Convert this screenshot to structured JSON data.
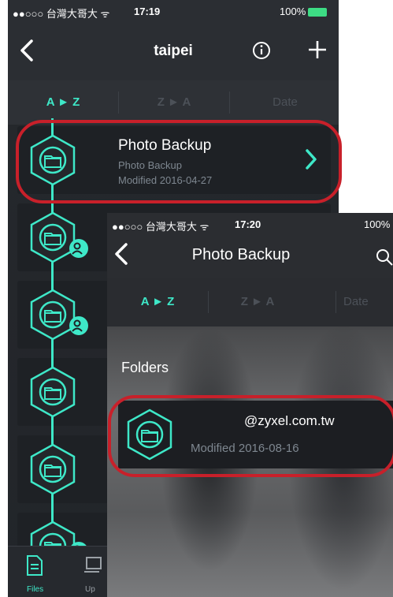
{
  "back_screen": {
    "status": {
      "carrier": "●●○○○ 台灣大哥大 ᯤ",
      "time": "17:19",
      "battery": "100%"
    },
    "title": "taipei",
    "sort_tabs": [
      {
        "label": "A ► Z",
        "active": true
      },
      {
        "label": "Z ► A",
        "active": false
      },
      {
        "label": "Date",
        "active": false
      }
    ],
    "items": [
      {
        "title": "Photo Backup",
        "subtitle": "Photo Backup",
        "modified": "Modified 2016-04-27",
        "shared": false
      }
    ],
    "tabbar": {
      "files": "Files",
      "upload": "Up"
    }
  },
  "front_screen": {
    "status": {
      "carrier": "●●○○○ 台灣大哥大 ᯤ",
      "time": "17:20",
      "battery": "100%"
    },
    "title": "Photo Backup",
    "sort_tabs": [
      {
        "label": "A ► Z",
        "active": true
      },
      {
        "label": "Z ► A",
        "active": false
      },
      {
        "label": "Date",
        "active": false
      }
    ],
    "section_label": "Folders",
    "folder": {
      "title": "@zyxel.com.tw",
      "modified": "Modified 2016-08-16"
    }
  },
  "colors": {
    "accent": "#3ee8c8",
    "highlight": "#c8202a",
    "row_bg": "#1e2125"
  }
}
